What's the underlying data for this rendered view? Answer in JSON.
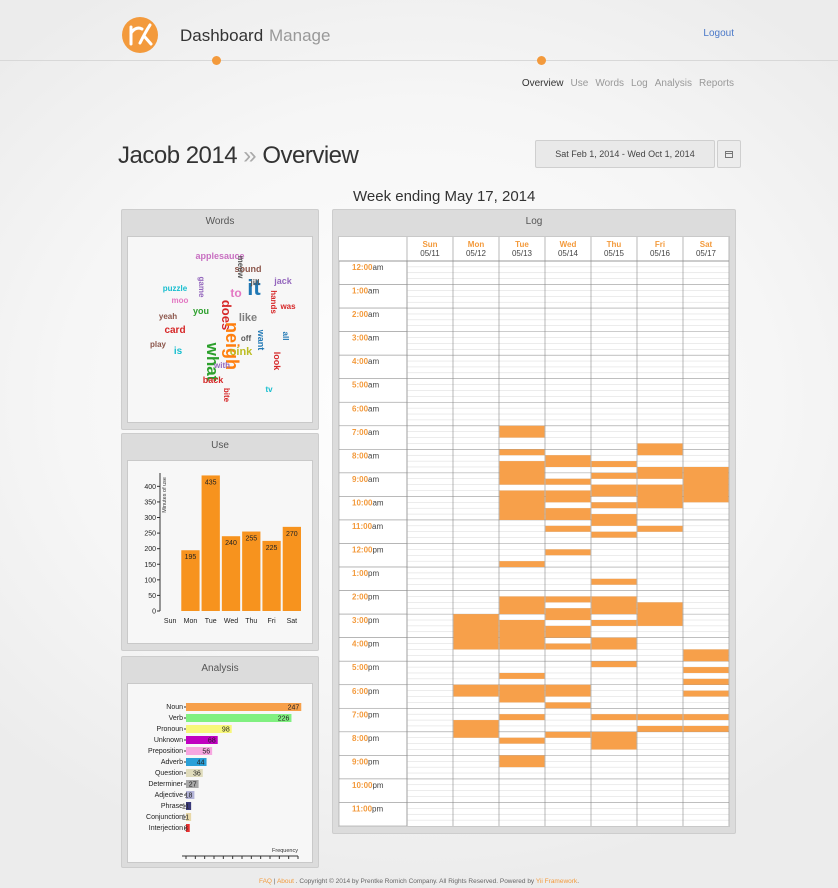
{
  "header": {
    "nav": [
      "Dashboard",
      "Manage"
    ],
    "logout": "Logout",
    "subnav": [
      "Overview",
      "Use",
      "Words",
      "Log",
      "Analysis",
      "Reports"
    ]
  },
  "page": {
    "title_name": "Jacob 2014",
    "title_sep": "»",
    "title_view": "Overview",
    "date_range": "Sat Feb 1, 2014 - Wed Oct 1, 2014",
    "week_title": "Week ending May 17, 2014"
  },
  "panels": {
    "words": "Words",
    "use": "Use",
    "analysis": "Analysis",
    "log": "Log"
  },
  "words_cloud": [
    {
      "w": "applesauce",
      "c": "#c86fc1"
    },
    {
      "w": "sound",
      "c": "#8c564b"
    },
    {
      "w": "jack",
      "c": "#9467bd"
    },
    {
      "w": "it",
      "c": "#1f77b4"
    },
    {
      "w": "jill",
      "c": "#555"
    },
    {
      "w": "to",
      "c": "#e377c2"
    },
    {
      "w": "puzzle",
      "c": "#17becf"
    },
    {
      "w": "moo",
      "c": "#e377c2"
    },
    {
      "w": "yeah",
      "c": "#8c564b"
    },
    {
      "w": "card",
      "c": "#d62728"
    },
    {
      "w": "you",
      "c": "#2ca02c"
    },
    {
      "w": "does",
      "c": "#d62728"
    },
    {
      "w": "neigh",
      "c": "#ff7f0e"
    },
    {
      "w": "like",
      "c": "#7f7f7f"
    },
    {
      "w": "was",
      "c": "#d62728"
    },
    {
      "w": "play",
      "c": "#8c564b"
    },
    {
      "w": "is",
      "c": "#17becf"
    },
    {
      "w": "what",
      "c": "#2ca02c"
    },
    {
      "w": "oink",
      "c": "#bcbd22"
    },
    {
      "w": "with",
      "c": "#9467bd"
    },
    {
      "w": "look",
      "c": "#d62728"
    },
    {
      "w": "back",
      "c": "#d62728"
    },
    {
      "w": "tv",
      "c": "#17becf"
    },
    {
      "w": "off",
      "c": "#555"
    },
    {
      "w": "want",
      "c": "#1f77b4"
    },
    {
      "w": "all",
      "c": "#1f77b4"
    },
    {
      "w": "hands",
      "c": "#d62728"
    },
    {
      "w": "game",
      "c": "#9467bd"
    },
    {
      "w": "meow",
      "c": "#555"
    },
    {
      "w": "bite",
      "c": "#d62728"
    }
  ],
  "chart_data": [
    {
      "type": "bar",
      "categories": [
        "Sun",
        "Mon",
        "Tue",
        "Wed",
        "Thu",
        "Fri",
        "Sat"
      ],
      "values": [
        0,
        195,
        435,
        240,
        255,
        225,
        270
      ],
      "ylabel": "Minutes of use",
      "ylim": [
        0,
        430
      ],
      "yticks": [
        0,
        50,
        100,
        150,
        200,
        250,
        300,
        350,
        400
      ],
      "color": "#f7931e"
    },
    {
      "type": "bar",
      "orientation": "horizontal",
      "categories": [
        "Noun",
        "Verb",
        "Pronoun",
        "Unknown",
        "Preposition",
        "Adverb",
        "Question",
        "Determiner",
        "Adjective",
        "Phrase",
        "Conjunction",
        "Interjection"
      ],
      "values": [
        247,
        226,
        98,
        68,
        56,
        44,
        36,
        27,
        18,
        11,
        11,
        8
      ],
      "colors": [
        "#f7a04a",
        "#80f080",
        "#f7f77a",
        "#c000c0",
        "#f7a6e0",
        "#2aa0d8",
        "#e0dcbc",
        "#a8a8a8",
        "#b4b4d8",
        "#3a3a7a",
        "#e8d8a8",
        "#e83030"
      ],
      "xlabel": "Frequency",
      "xticks": [
        0,
        20,
        40,
        60,
        80,
        100,
        120,
        140,
        160,
        180,
        200,
        220,
        240
      ],
      "xlim": [
        0,
        240
      ]
    },
    {
      "type": "heatmap",
      "days": [
        {
          "d": "Sun",
          "date": "05/11"
        },
        {
          "d": "Mon",
          "date": "05/12"
        },
        {
          "d": "Tue",
          "date": "05/13"
        },
        {
          "d": "Wed",
          "date": "05/14"
        },
        {
          "d": "Thu",
          "date": "05/15"
        },
        {
          "d": "Fri",
          "date": "05/16"
        },
        {
          "d": "Sat",
          "date": "05/17"
        }
      ],
      "hours": [
        {
          "h": "12:00",
          "ap": "am"
        },
        {
          "h": "1:00",
          "ap": "am"
        },
        {
          "h": "2:00",
          "ap": "am"
        },
        {
          "h": "3:00",
          "ap": "am"
        },
        {
          "h": "4:00",
          "ap": "am"
        },
        {
          "h": "5:00",
          "ap": "am"
        },
        {
          "h": "6:00",
          "ap": "am"
        },
        {
          "h": "7:00",
          "ap": "am"
        },
        {
          "h": "8:00",
          "ap": "am"
        },
        {
          "h": "9:00",
          "ap": "am"
        },
        {
          "h": "10:00",
          "ap": "am"
        },
        {
          "h": "11:00",
          "ap": "am"
        },
        {
          "h": "12:00",
          "ap": "pm"
        },
        {
          "h": "1:00",
          "ap": "pm"
        },
        {
          "h": "2:00",
          "ap": "pm"
        },
        {
          "h": "3:00",
          "ap": "pm"
        },
        {
          "h": "4:00",
          "ap": "pm"
        },
        {
          "h": "5:00",
          "ap": "pm"
        },
        {
          "h": "6:00",
          "ap": "pm"
        },
        {
          "h": "7:00",
          "ap": "pm"
        },
        {
          "h": "8:00",
          "ap": "pm"
        },
        {
          "h": "9:00",
          "ap": "pm"
        },
        {
          "h": "10:00",
          "ap": "pm"
        },
        {
          "h": "11:00",
          "ap": "pm"
        }
      ],
      "slots_per_hour": 4,
      "active_color": "#f7a04a",
      "activity": [
        {
          "day": 2,
          "from": 7.0,
          "to": 7.5
        },
        {
          "day": 2,
          "from": 8.0,
          "to": 8.25
        },
        {
          "day": 2,
          "from": 8.5,
          "to": 9.5
        },
        {
          "day": 2,
          "from": 9.75,
          "to": 11.0
        },
        {
          "day": 2,
          "from": 12.75,
          "to": 13.0
        },
        {
          "day": 2,
          "from": 14.25,
          "to": 15.0
        },
        {
          "day": 2,
          "from": 15.25,
          "to": 16.5
        },
        {
          "day": 2,
          "from": 17.5,
          "to": 17.75
        },
        {
          "day": 2,
          "from": 18.0,
          "to": 18.75
        },
        {
          "day": 2,
          "from": 19.25,
          "to": 19.5
        },
        {
          "day": 2,
          "from": 20.25,
          "to": 20.5
        },
        {
          "day": 2,
          "from": 21.0,
          "to": 21.5
        },
        {
          "day": 3,
          "from": 8.25,
          "to": 8.75
        },
        {
          "day": 3,
          "from": 9.25,
          "to": 9.5
        },
        {
          "day": 3,
          "from": 9.75,
          "to": 10.25
        },
        {
          "day": 3,
          "from": 10.5,
          "to": 11.0
        },
        {
          "day": 3,
          "from": 11.25,
          "to": 11.5
        },
        {
          "day": 3,
          "from": 12.25,
          "to": 12.5
        },
        {
          "day": 3,
          "from": 14.25,
          "to": 14.5
        },
        {
          "day": 3,
          "from": 14.75,
          "to": 15.25
        },
        {
          "day": 3,
          "from": 15.5,
          "to": 16.0
        },
        {
          "day": 3,
          "from": 16.25,
          "to": 16.5
        },
        {
          "day": 3,
          "from": 18.0,
          "to": 18.5
        },
        {
          "day": 3,
          "from": 18.75,
          "to": 19.0
        },
        {
          "day": 3,
          "from": 20.0,
          "to": 20.25
        },
        {
          "day": 4,
          "from": 8.5,
          "to": 8.75
        },
        {
          "day": 4,
          "from": 9.0,
          "to": 9.25
        },
        {
          "day": 4,
          "from": 9.5,
          "to": 10.0
        },
        {
          "day": 4,
          "from": 10.25,
          "to": 10.5
        },
        {
          "day": 4,
          "from": 10.75,
          "to": 11.25
        },
        {
          "day": 4,
          "from": 11.5,
          "to": 11.75
        },
        {
          "day": 4,
          "from": 13.5,
          "to": 13.75
        },
        {
          "day": 4,
          "from": 14.25,
          "to": 15.0
        },
        {
          "day": 4,
          "from": 15.25,
          "to": 15.5
        },
        {
          "day": 4,
          "from": 16.0,
          "to": 16.5
        },
        {
          "day": 4,
          "from": 17.0,
          "to": 17.25
        },
        {
          "day": 4,
          "from": 19.25,
          "to": 19.5
        },
        {
          "day": 4,
          "from": 20.0,
          "to": 20.75
        },
        {
          "day": 1,
          "from": 15.0,
          "to": 16.5
        },
        {
          "day": 1,
          "from": 18.0,
          "to": 18.5
        },
        {
          "day": 1,
          "from": 19.5,
          "to": 20.25
        },
        {
          "day": 5,
          "from": 7.75,
          "to": 8.25
        },
        {
          "day": 5,
          "from": 8.75,
          "to": 9.25
        },
        {
          "day": 5,
          "from": 9.5,
          "to": 10.5
        },
        {
          "day": 5,
          "from": 11.25,
          "to": 11.5
        },
        {
          "day": 5,
          "from": 14.5,
          "to": 15.5
        },
        {
          "day": 5,
          "from": 19.25,
          "to": 19.5
        },
        {
          "day": 5,
          "from": 19.75,
          "to": 20.0
        },
        {
          "day": 6,
          "from": 8.75,
          "to": 10.25
        },
        {
          "day": 6,
          "from": 16.5,
          "to": 17.0
        },
        {
          "day": 6,
          "from": 17.25,
          "to": 17.5
        },
        {
          "day": 6,
          "from": 17.75,
          "to": 18.0
        },
        {
          "day": 6,
          "from": 18.25,
          "to": 18.5
        },
        {
          "day": 6,
          "from": 19.25,
          "to": 19.5
        },
        {
          "day": 6,
          "from": 19.75,
          "to": 20.0
        }
      ]
    }
  ],
  "footer": {
    "faq": "FAQ",
    "about": "About",
    "text": ". Copyright © 2014 by Prentke Romich Company. All Rights Reserved. Powered by",
    "yii": "Yii Framework",
    "end": "."
  }
}
